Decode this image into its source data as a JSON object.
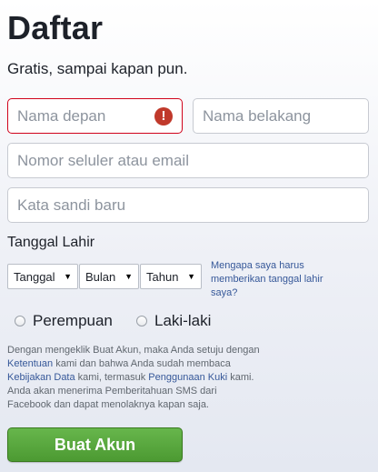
{
  "header": {
    "title": "Daftar",
    "subtitle": "Gratis, sampai kapan pun."
  },
  "form": {
    "first_name_placeholder": "Nama depan",
    "last_name_placeholder": "Nama belakang",
    "contact_placeholder": "Nomor seluler atau email",
    "password_placeholder": "Kata sandi baru",
    "error_icon": "!"
  },
  "birthday": {
    "label": "Tanggal Lahir",
    "day": "Tanggal",
    "month": "Bulan",
    "year": "Tahun",
    "arrow": "▼",
    "why_link": "Mengapa saya harus memberikan tanggal lahir saya?"
  },
  "gender": {
    "female": "Perempuan",
    "male": "Laki-laki"
  },
  "terms": {
    "part1": "Dengan mengeklik Buat Akun, maka Anda setuju dengan ",
    "link_terms": "Ketentuan",
    "part2": " kami dan bahwa Anda sudah membaca ",
    "link_data_policy": "Kebijakan Data",
    "part3": " kami, termasuk ",
    "link_cookie": "Penggunaan Kuki",
    "part4": " kami. Anda akan menerima Pemberitahuan SMS dari Facebook dan dapat menolaknya kapan saja."
  },
  "submit_label": "Buat Akun",
  "colors": {
    "error": "#d0021b",
    "link": "#365899",
    "button": "#4c9a32"
  }
}
